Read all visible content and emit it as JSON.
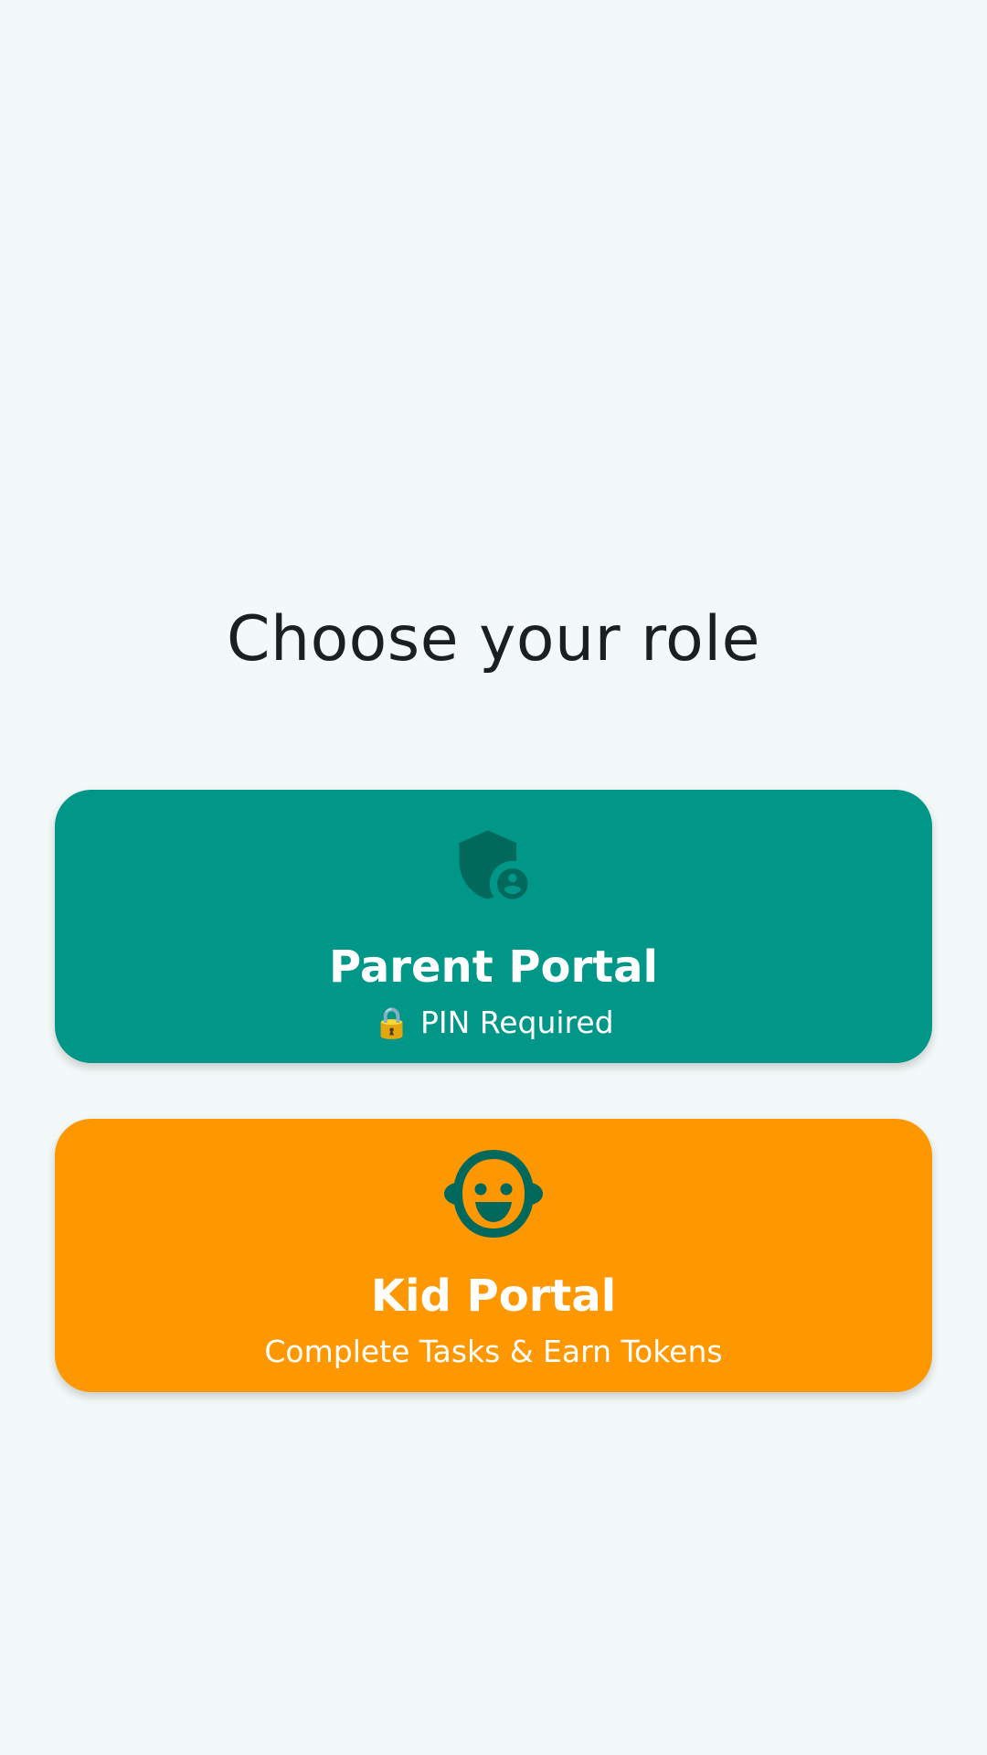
{
  "page": {
    "title": "Choose your role"
  },
  "roles": [
    {
      "key": "parent",
      "title": "Parent Portal",
      "subtitle_emoji": "🔒",
      "subtitle_text": "PIN Required",
      "icon": "admin-shield-icon",
      "color": "#009688",
      "icon_color": "#00695C"
    },
    {
      "key": "kid",
      "title": "Kid Portal",
      "subtitle_text": "Complete Tasks & Earn Tokens",
      "icon": "child-face-icon",
      "color": "#FF9800",
      "icon_color": "#00695C"
    }
  ],
  "colors": {
    "background": "#F3F9F8",
    "title_text": "#1B1F1F",
    "card_text": "#FFFFFF"
  }
}
